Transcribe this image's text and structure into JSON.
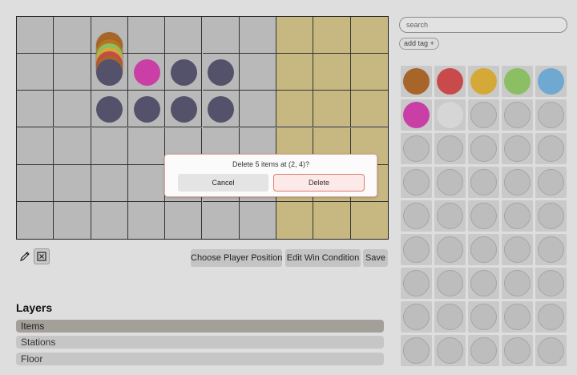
{
  "colors": {
    "grid_cell": "#b9b9b9",
    "win_zone": "#c7b882",
    "grid_line": "#333333",
    "dialog_border": "#e1a39c",
    "delete_border": "#e07a6f"
  },
  "board": {
    "columns": 10,
    "rows": 6,
    "win_zone_columns": [
      7,
      8,
      9
    ],
    "tokens": [
      {
        "col": 2,
        "row": 0,
        "color": "#a7652a",
        "stack": true
      },
      {
        "col": 2,
        "row": 1,
        "color": "#54516a",
        "stack_colors": [
          "#a7652a",
          "#c94a4a",
          "#d4a937",
          "#8cbf63",
          "#b8741f"
        ]
      },
      {
        "col": 3,
        "row": 1,
        "color": "#c93fa6"
      },
      {
        "col": 4,
        "row": 1,
        "color": "#54516a"
      },
      {
        "col": 5,
        "row": 1,
        "color": "#54516a"
      },
      {
        "col": 2,
        "row": 2,
        "color": "#54516a"
      },
      {
        "col": 3,
        "row": 2,
        "color": "#54516a"
      },
      {
        "col": 4,
        "row": 2,
        "color": "#54516a"
      },
      {
        "col": 5,
        "row": 2,
        "color": "#54516a"
      }
    ]
  },
  "toolbar": {
    "pencil_icon": "pencil-icon",
    "eraser_icon": "eraser-icon",
    "choose_player_position": "Choose Player Position",
    "edit_win_condition": "Edit Win Condition",
    "save": "Save"
  },
  "layers": {
    "title": "Layers",
    "items": [
      {
        "label": "Items",
        "active": true
      },
      {
        "label": "Stations",
        "active": false
      },
      {
        "label": "Floor",
        "active": false
      }
    ]
  },
  "sidebar": {
    "search_placeholder": "search",
    "add_tag_label": "add tag +",
    "palette_columns": 5,
    "palette_rows": 9,
    "swatches": [
      "#a7652a",
      "#c94a4a",
      "#d4a937",
      "#8cbf63",
      "#6fa8d1",
      "#c93fa6",
      "#d6d6d6"
    ],
    "empty_swatch": "#bdbdbd"
  },
  "dialog": {
    "message": "Delete 5 items at (2, 4)?",
    "cancel_label": "Cancel",
    "delete_label": "Delete"
  }
}
